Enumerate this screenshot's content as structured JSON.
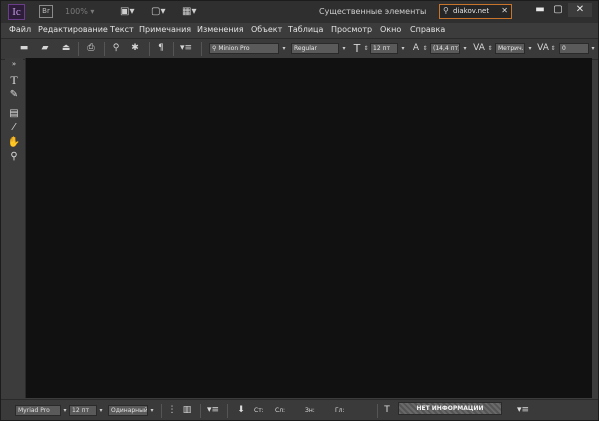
{
  "titlebar": {
    "app_logo": "Ic",
    "bridge_label": "Br",
    "zoom": "100%",
    "workspace": "Существенные элементы",
    "search_value": "diakov.net"
  },
  "menu": [
    "Файл",
    "Редактирование",
    "Текст",
    "Примечания",
    "Изменения",
    "Объект",
    "Таблица",
    "Просмотр",
    "Окно",
    "Справка"
  ],
  "controlbar": {
    "font_family": "Minion Pro",
    "font_style": "Regular",
    "font_size": "12 пт",
    "leading": "(14,4 пт)",
    "kerning": "Метрич.",
    "tracking": "0"
  },
  "statusbar": {
    "font_family": "Myriad Pro",
    "font_size": "12 пт",
    "spacing": "Одинарный и",
    "st_label": "Ст:",
    "sl_label": "Сл:",
    "zn_label": "Зн:",
    "gl_label": "Гл:",
    "no_info": "НЕТ ИНФОРМАЦИИ"
  },
  "icons": {
    "collapse": "»",
    "type_tool": "T",
    "note_tool": "✎",
    "eyedropper_tool": "⁄",
    "hand_tool": "✋",
    "zoom_tool": "⚲"
  }
}
